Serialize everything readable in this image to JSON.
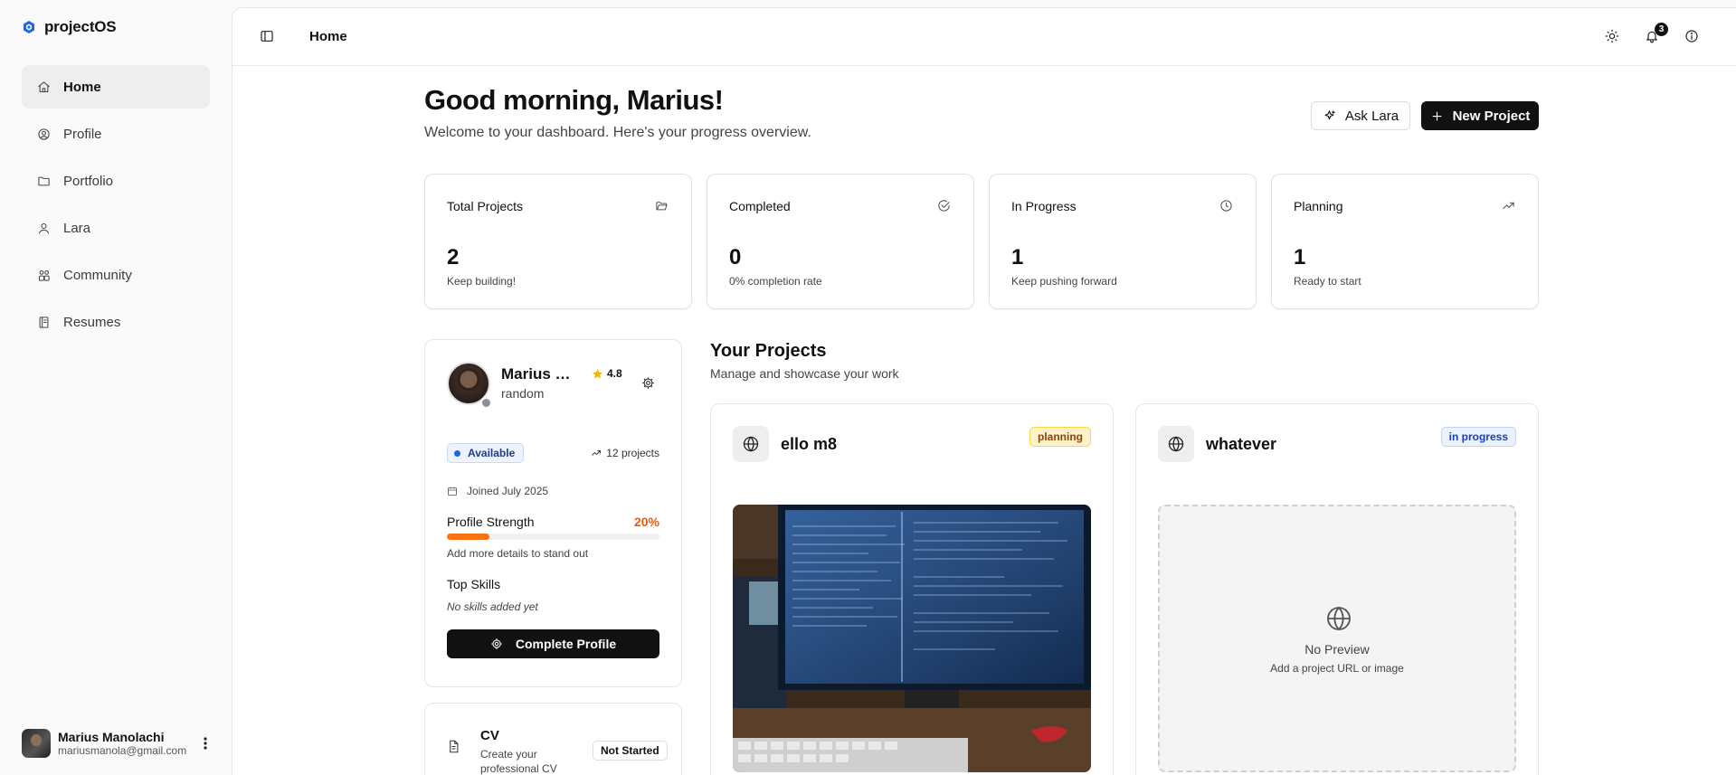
{
  "app": {
    "name": "projectOS",
    "accent": "#111111"
  },
  "sidebar": {
    "items": [
      {
        "label": "Home",
        "icon": "home-icon",
        "active": true
      },
      {
        "label": "Profile",
        "icon": "user-circle-icon",
        "active": false
      },
      {
        "label": "Portfolio",
        "icon": "folder-icon",
        "active": false
      },
      {
        "label": "Lara",
        "icon": "user-icon",
        "active": false
      },
      {
        "label": "Community",
        "icon": "users-icon",
        "active": false
      },
      {
        "label": "Resumes",
        "icon": "book-icon",
        "active": false
      }
    ],
    "user": {
      "name": "Marius Manolachi",
      "email": "mariusmanola@gmail.com"
    }
  },
  "topbar": {
    "title": "Home",
    "notification_count": "3"
  },
  "header": {
    "greeting": "Good morning, Marius!",
    "subtitle": "Welcome to your dashboard. Here's your progress overview.",
    "ask_label": "Ask Lara",
    "new_label": "New Project"
  },
  "stats": [
    {
      "label": "Total Projects",
      "value": "2",
      "caption": "Keep building!",
      "icon": "folder-open-icon"
    },
    {
      "label": "Completed",
      "value": "0",
      "caption": "0% completion rate",
      "icon": "check-circle-icon"
    },
    {
      "label": "In Progress",
      "value": "1",
      "caption": "Keep pushing forward",
      "icon": "clock-icon"
    },
    {
      "label": "Planning",
      "value": "1",
      "caption": "Ready to start",
      "icon": "trending-up-icon"
    }
  ],
  "profile": {
    "name": "Marius Manolachi",
    "rating": "4.8",
    "handle": "random",
    "availability": "Available",
    "projects": "12 projects",
    "joined": "Joined July 2025",
    "strength_label": "Profile Strength",
    "strength_value": "20%",
    "strength_fraction": 0.2,
    "hint": "Add more details to stand out",
    "skills_title": "Top Skills",
    "skills_empty": "No skills added yet",
    "complete_label": "Complete Profile"
  },
  "cv": {
    "title": "CV",
    "desc": "Create your professional CV",
    "status": "Not Started"
  },
  "projects": {
    "title": "Your Projects",
    "subtitle": "Manage and showcase your work",
    "items": [
      {
        "name": "ello m8",
        "status": "planning",
        "has_preview": true
      },
      {
        "name": "whatever",
        "status": "in progress",
        "has_preview": false,
        "empty_title": "No Preview",
        "empty_sub": "Add a project URL or image"
      }
    ]
  }
}
